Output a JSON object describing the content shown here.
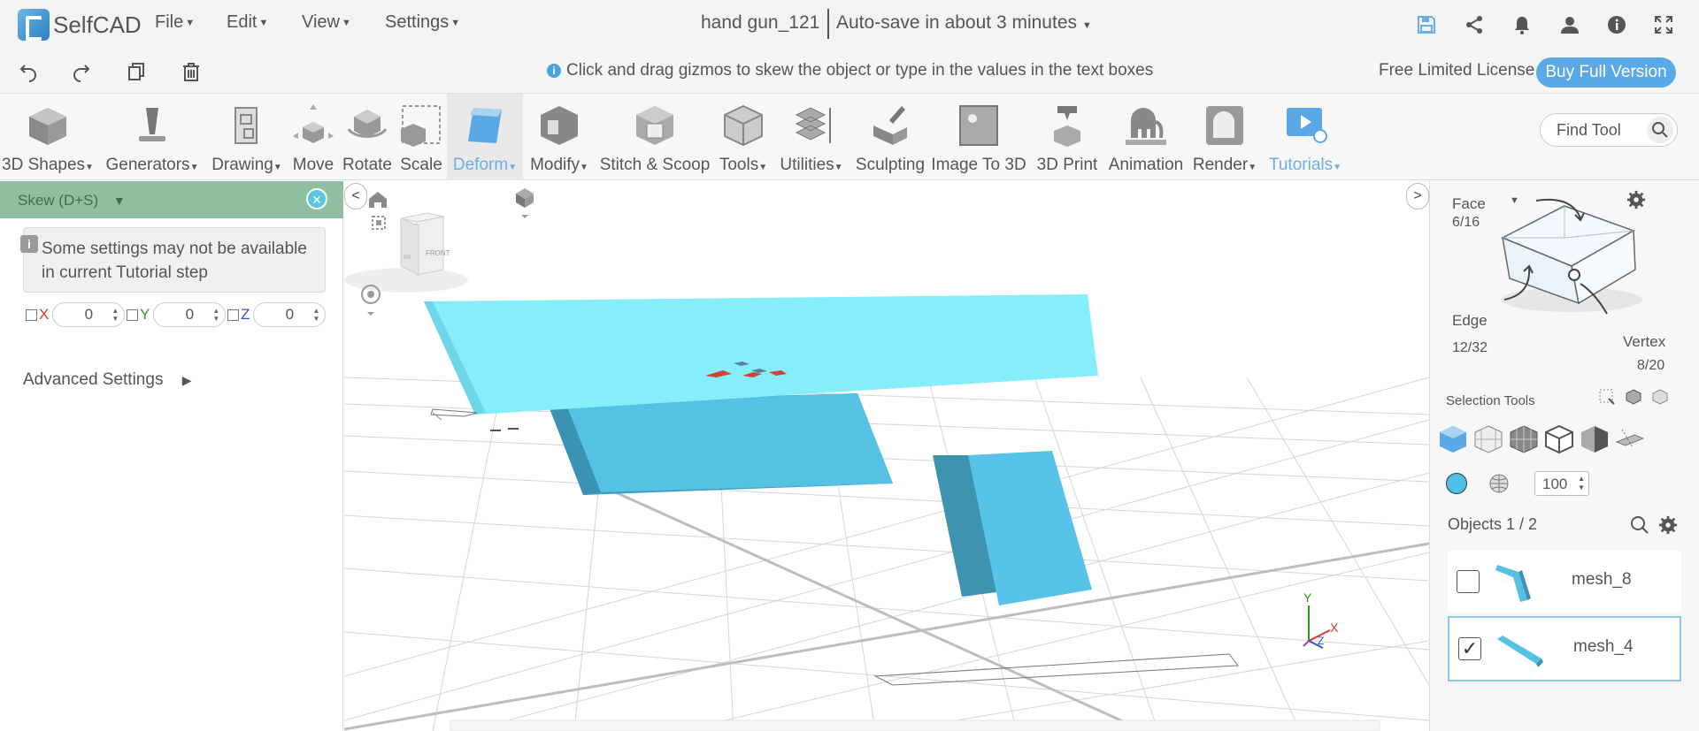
{
  "app": {
    "logo": "SelfCAD"
  },
  "menu": {
    "file": "File",
    "edit": "Edit",
    "view": "View",
    "settings": "Settings"
  },
  "project": {
    "title": "hand gun_121",
    "autosave": "Auto-save in about 3 minutes"
  },
  "hint": {
    "text": "Click and drag gizmos to skew the object or type in the values in the text boxes"
  },
  "license": {
    "label": "Free Limited License",
    "buy": "Buy Full Version"
  },
  "tools": [
    {
      "label": "3D Shapes"
    },
    {
      "label": "Generators"
    },
    {
      "label": "Drawing"
    },
    {
      "label": "Move"
    },
    {
      "label": "Rotate"
    },
    {
      "label": "Scale"
    },
    {
      "label": "Deform"
    },
    {
      "label": "Modify"
    },
    {
      "label": "Stitch & Scoop"
    },
    {
      "label": "Tools"
    },
    {
      "label": "Utilities"
    },
    {
      "label": "Sculpting"
    },
    {
      "label": "Image To 3D"
    },
    {
      "label": "3D Print"
    },
    {
      "label": "Animation"
    },
    {
      "label": "Render"
    },
    {
      "label": "Tutorials"
    }
  ],
  "find_tool": {
    "placeholder": "Find Tool"
  },
  "skew_panel": {
    "title": "Skew (D+S)",
    "note": "Some settings may not be available in current Tutorial step",
    "x_label": "X",
    "y_label": "Y",
    "z_label": "Z",
    "x_value": "0",
    "y_value": "0",
    "z_value": "0",
    "advanced": "Advanced Settings"
  },
  "viewcube": {
    "front": "FRONT",
    "side": "ER"
  },
  "gizmo_axes": {
    "y": "Y",
    "x": "X",
    "z": "Z"
  },
  "selection": {
    "face_label": "Face",
    "face_count": "6/16",
    "edge_label": "Edge",
    "edge_count": "12/32",
    "vertex_label": "Vertex",
    "vertex_count": "8/20",
    "tools_label": "Selection Tools",
    "brush_size": "100"
  },
  "objects": {
    "header": "Objects 1 / 2",
    "items": [
      {
        "name": "mesh_8",
        "checked": false
      },
      {
        "name": "mesh_4",
        "checked": true
      }
    ]
  },
  "colors": {
    "accent": "#5aa9e6",
    "mesh": "#5cc8e8",
    "panel_head": "#8fbfa0"
  }
}
